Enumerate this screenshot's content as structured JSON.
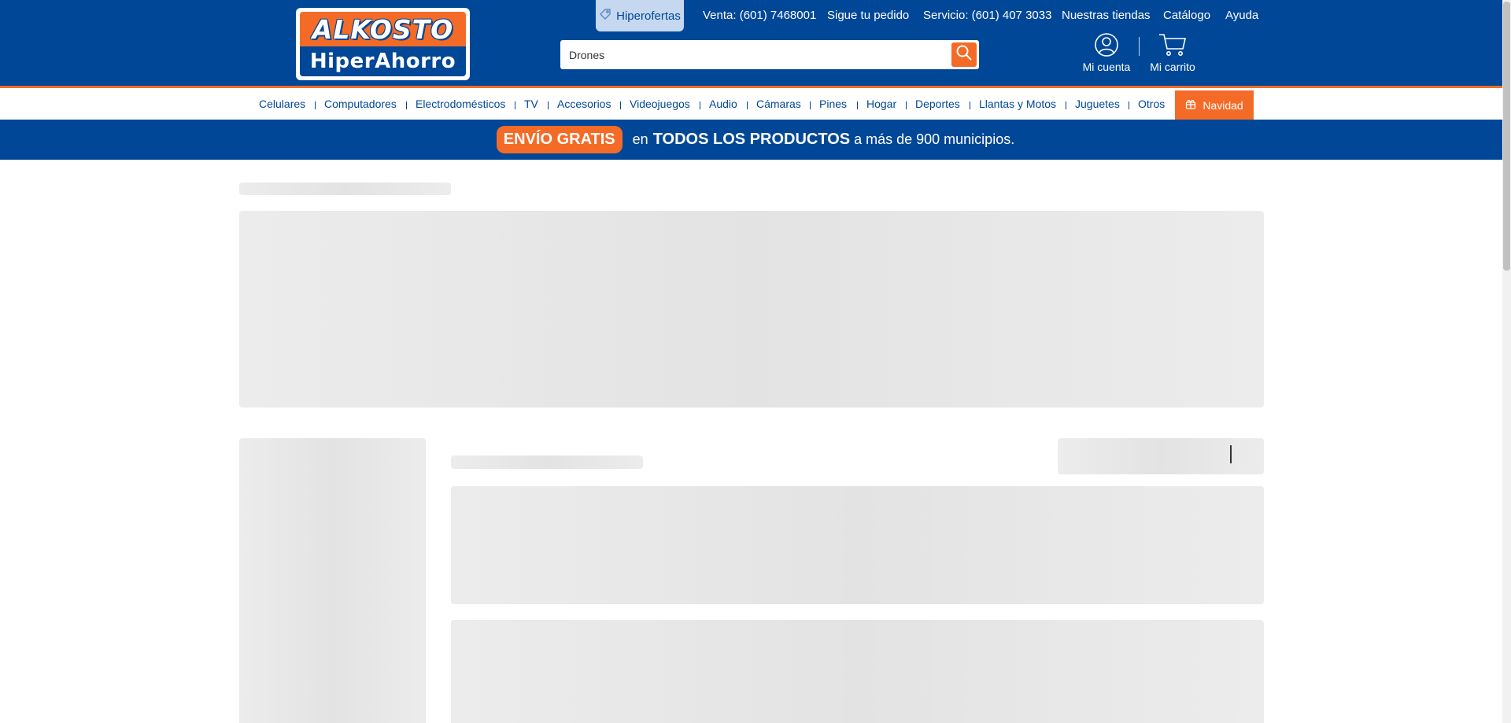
{
  "header": {
    "logo": {
      "top": "ALKOSTO",
      "bottom": "HiperAhorro"
    },
    "hiperofertas": "Hiperofertas",
    "top_links": [
      "Venta: (601) 7468001",
      "Sigue tu pedido",
      "Servicio: (601) 407 3033",
      "Nuestras tiendas",
      "Catálogo",
      "Ayuda"
    ],
    "search": {
      "value": "Drones"
    },
    "account_label": "Mi cuenta",
    "cart_label": "Mi carrito"
  },
  "categories": [
    "Celulares",
    "Computadores",
    "Electrodomésticos",
    "TV",
    "Accesorios",
    "Videojuegos",
    "Audio",
    "Cámaras",
    "Pines",
    "Hogar",
    "Deportes",
    "Llantas y Motos",
    "Juguetes",
    "Otros"
  ],
  "navidad_label": "Navidad",
  "promo": {
    "badge": "ENVÍO GRATIS",
    "pre": "en",
    "strong": "TODOS LOS PRODUCTOS",
    "post": "a más de 900 municipios."
  },
  "colors": {
    "brand_blue": "#004797",
    "brand_orange": "#f46b27",
    "skeleton": "#e8e8e8"
  }
}
